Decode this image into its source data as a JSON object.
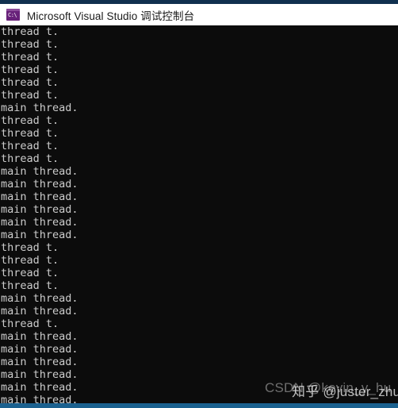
{
  "window": {
    "title": "Microsoft Visual Studio 调试控制台",
    "icon_name": "console-app-icon",
    "icon_glyph": "C:\\",
    "titlebar_bg": "#ffffff",
    "titlebar_text_color": "#1a1a1a",
    "top_strip_color": "#10304f",
    "bottom_strip_color": "#1b618f"
  },
  "console": {
    "background": "#0c0c0c",
    "foreground": "#cccccc",
    "lines": [
      "thread t.",
      "thread t.",
      "thread t.",
      "thread t.",
      "thread t.",
      "thread t.",
      "main thread.",
      "thread t.",
      "thread t.",
      "thread t.",
      "thread t.",
      "main thread.",
      "main thread.",
      "main thread.",
      "main thread.",
      "main thread.",
      "main thread.",
      "thread t.",
      "thread t.",
      "thread t.",
      "thread t.",
      "main thread.",
      "main thread.",
      "thread t.",
      "main thread.",
      "main thread.",
      "main thread.",
      "main thread.",
      "main thread.",
      "main thread."
    ]
  },
  "watermarks": {
    "csdn": "CSDN @kevin_y_hu",
    "zhihu": "知乎 @juster_zhu"
  }
}
